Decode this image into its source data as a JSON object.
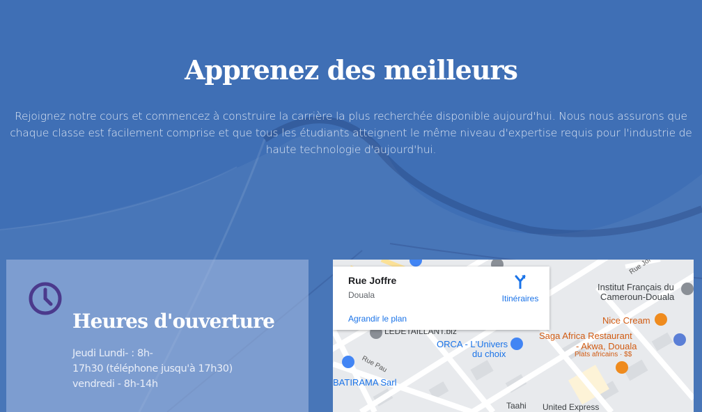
{
  "hero": {
    "title": "Apprenez des meilleurs",
    "text": "Rejoignez notre cours et commencez à construire la carrière la plus recherchée disponible aujourd'hui. Nous nous assurons que chaque classe est facilement comprise et que tous les étudiants atteignent le même niveau d'expertise requis pour l'industrie de haute technologie d'aujourd'hui."
  },
  "hours": {
    "title": "Heures d'ouverture",
    "lines": [
      "Jeudi Lundi- : 8h-",
      "17h30 (téléphone jusqu'à 17h30)",
      "vendredi - 8h-14h"
    ],
    "icon": "clock-icon"
  },
  "map": {
    "info": {
      "title": "Rue Joffre",
      "city": "Douala",
      "directions_label": "Itinéraires",
      "enlarge_label": "Agrandir le plan"
    },
    "places": {
      "institut_line1": "Institut Français du",
      "institut_line2": "Cameroun-Douala",
      "nice_cream": "Nice Cream",
      "saga_line1": "Saga Africa Restaurant",
      "saga_line2": "- Akwa, Douala",
      "saga_sub": "Plats africains · $$",
      "orca_line1": "ORCA - L'Univers",
      "orca_line2": "du choix",
      "ledetaillant": "LEDETAILLANT.biz",
      "batirama": "BATIRAMA Sarl",
      "taahi": "Taahi",
      "united_express": "United Express"
    },
    "streets": {
      "rue_pau": "Rue Pau",
      "rue_joffre": "Rue Jof"
    }
  },
  "colors": {
    "background": "#3f6fb5",
    "accent_clock": "#4b3a8c",
    "map_link": "#1a73e8",
    "restaurant": "#d15b12"
  }
}
